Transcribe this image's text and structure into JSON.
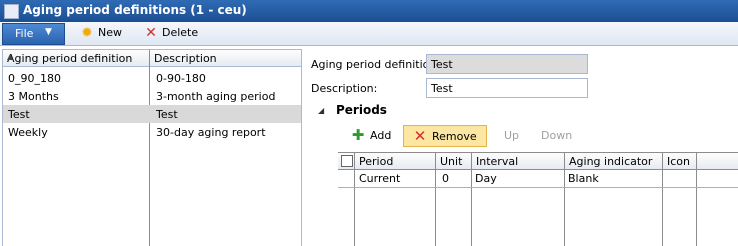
{
  "window": {
    "title": "Aging period definitions (1 - ceu)"
  },
  "toolbar": {
    "file_label": "File",
    "new_label": "New",
    "delete_label": "Delete"
  },
  "list": {
    "columns": [
      "Aging period definition",
      "Description"
    ],
    "rows": [
      {
        "name": "0_90_180",
        "description": "0-90-180"
      },
      {
        "name": "3 Months",
        "description": "3-month aging period"
      },
      {
        "name": "Test",
        "description": "Test",
        "selected": true
      },
      {
        "name": "Weekly",
        "description": "30-day aging report"
      }
    ]
  },
  "details": {
    "definition_label": "Aging period definition:",
    "definition_value": "Test",
    "description_label": "Description:",
    "description_value": "Test"
  },
  "periods": {
    "title": "Periods",
    "add_label": "Add",
    "remove_label": "Remove",
    "up_label": "Up",
    "down_label": "Down",
    "columns": [
      "Period",
      "Unit",
      "Interval",
      "Aging indicator",
      "Icon"
    ],
    "rows": [
      {
        "period": "Current",
        "unit": "0",
        "interval": "Day",
        "aging_indicator": "Blank",
        "icon": ""
      }
    ]
  },
  "colors": {
    "titlebar": "#1c4f93",
    "file_button": "#2a62b0",
    "selected_row": "#d9d9d9",
    "remove_highlight": "#fbe6a2"
  },
  "icons": {
    "new": "sun-icon",
    "delete": "red-x-icon",
    "add": "green-plus-icon",
    "remove": "red-x-icon"
  }
}
